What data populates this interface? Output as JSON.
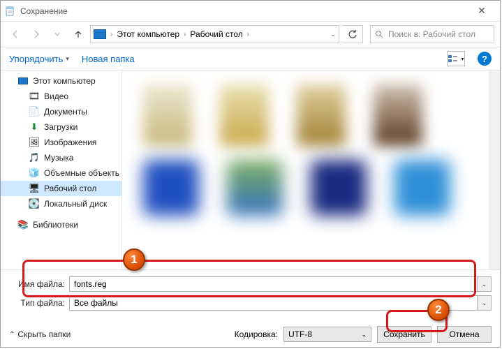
{
  "titlebar": {
    "title": "Сохранение"
  },
  "nav": {
    "address_parts": [
      "Этот компьютер",
      "Рабочий стол"
    ],
    "search_placeholder": "Поиск в: Рабочий стол"
  },
  "toolbar": {
    "organize": "Упорядочить",
    "new_folder": "Новая папка"
  },
  "sidebar": {
    "this_pc": "Этот компьютер",
    "items": [
      {
        "icon": "🎞",
        "label": "Видео"
      },
      {
        "icon": "📄",
        "label": "Документы"
      },
      {
        "icon": "⬇",
        "label": "Загрузки",
        "color": "#0a8a2a"
      },
      {
        "icon": "🖼",
        "label": "Изображения"
      },
      {
        "icon": "🎵",
        "label": "Музыка"
      },
      {
        "icon": "🧊",
        "label": "Объемные объекты"
      },
      {
        "icon": "🖥",
        "label": "Рабочий стол",
        "selected": true
      },
      {
        "icon": "💽",
        "label": "Локальный диск"
      }
    ],
    "libraries": "Библиотеки"
  },
  "form": {
    "filename_label": "Имя файла:",
    "filename_value": "fonts.reg",
    "filetype_label": "Тип файла:",
    "filetype_value": "Все файлы"
  },
  "actions": {
    "hide_folders": "Скрыть папки",
    "encoding_label": "Кодировка:",
    "encoding_value": "UTF-8",
    "save": "Сохранить",
    "cancel": "Отмена"
  },
  "markers": {
    "one": "1",
    "two": "2"
  }
}
